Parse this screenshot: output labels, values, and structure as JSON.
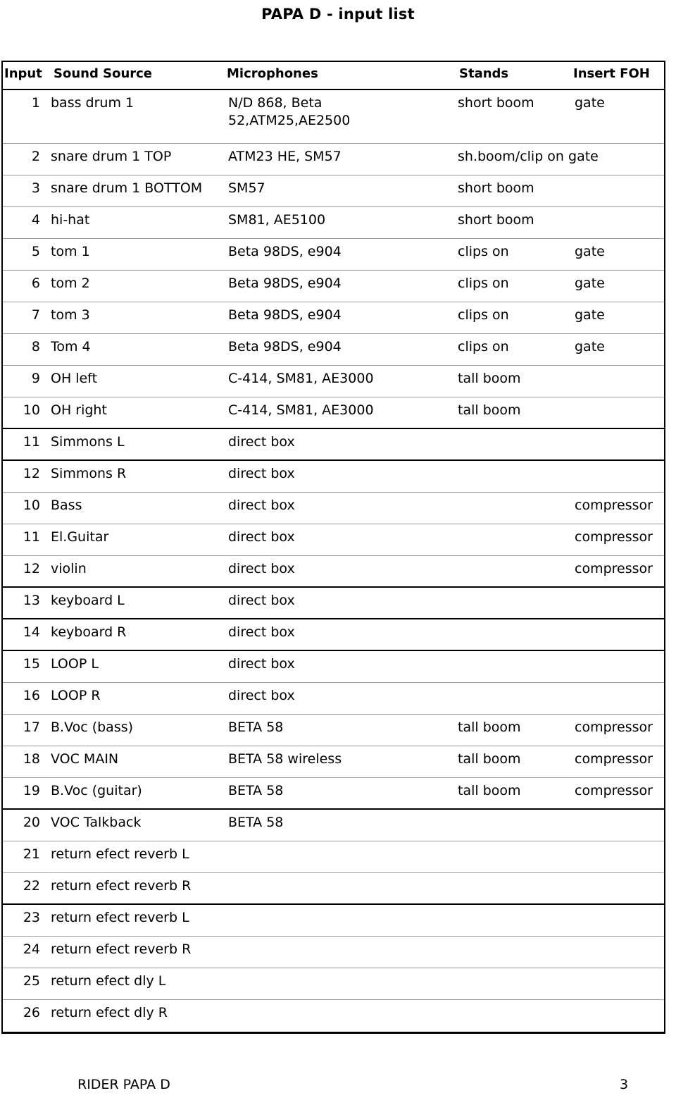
{
  "document": {
    "title": "PAPA D - input list"
  },
  "table": {
    "columns": [
      {
        "key": "input",
        "label": "Input"
      },
      {
        "key": "source",
        "label": "Sound Source"
      },
      {
        "key": "mic",
        "label": "Microphones"
      },
      {
        "key": "stand",
        "label": "Stands"
      },
      {
        "key": "insert",
        "label": "Insert FOH"
      }
    ],
    "rows": [
      {
        "input": "1",
        "source": "bass drum 1",
        "mic": "N/D 868, Beta\n52,ATM25,AE2500",
        "stand": "short boom",
        "insert": "gate"
      },
      {
        "input": "2",
        "source": "snare drum 1 TOP",
        "mic": "ATM23 HE, SM57",
        "stand": "sh.boom/clip on gate",
        "insert": ""
      },
      {
        "input": "3",
        "source": "snare drum 1 BOTTOM",
        "mic": "SM57",
        "stand": "short boom",
        "insert": ""
      },
      {
        "input": "4",
        "source": "hi-hat",
        "mic": "SM81, AE5100",
        "stand": "short boom",
        "insert": ""
      },
      {
        "input": "5",
        "source": "tom 1",
        "mic": "Beta 98DS, e904",
        "stand": "clips on",
        "insert": "gate"
      },
      {
        "input": "6",
        "source": "tom 2",
        "mic": "Beta 98DS, e904",
        "stand": "clips on",
        "insert": "gate"
      },
      {
        "input": "7",
        "source": "tom 3",
        "mic": "Beta 98DS, e904",
        "stand": "clips on",
        "insert": "gate"
      },
      {
        "input": "8",
        "source": "Tom 4",
        "mic": "Beta 98DS, e904",
        "stand": "clips on",
        "insert": "gate"
      },
      {
        "input": "9",
        "source": "OH left",
        "mic": "C-414, SM81, AE3000",
        "stand": "tall boom",
        "insert": ""
      },
      {
        "input": "10",
        "source": "OH right",
        "mic": "C-414, SM81, AE3000",
        "stand": "tall boom",
        "insert": ""
      },
      {
        "input": "11",
        "source": "Simmons L",
        "mic": "direct box",
        "stand": "",
        "insert": ""
      },
      {
        "input": "12",
        "source": "Simmons R",
        "mic": "direct box",
        "stand": "",
        "insert": ""
      },
      {
        "input": "10",
        "source": "Bass",
        "mic": "direct box",
        "stand": "",
        "insert": "compressor"
      },
      {
        "input": "11",
        "source": "El.Guitar",
        "mic": "direct box",
        "stand": "",
        "insert": "compressor"
      },
      {
        "input": "12",
        "source": "violin",
        "mic": "direct box",
        "stand": "",
        "insert": "compressor"
      },
      {
        "input": "13",
        "source": "keyboard L",
        "mic": "direct box",
        "stand": "",
        "insert": ""
      },
      {
        "input": "14",
        "source": "keyboard R",
        "mic": "direct box",
        "stand": "",
        "insert": ""
      },
      {
        "input": "15",
        "source": "LOOP L",
        "mic": "direct box",
        "stand": "",
        "insert": ""
      },
      {
        "input": "16",
        "source": "LOOP R",
        "mic": "direct box",
        "stand": "",
        "insert": ""
      },
      {
        "input": "17",
        "source": "B.Voc (bass)",
        "mic": "BETA 58",
        "stand": "tall boom",
        "insert": "compressor"
      },
      {
        "input": "18",
        "source": "VOC MAIN",
        "mic": "BETA 58 wireless",
        "stand": "tall boom",
        "insert": "compressor"
      },
      {
        "input": "19",
        "source": "B.Voc (guitar)",
        "mic": "BETA 58",
        "stand": "tall boom",
        "insert": "compressor"
      },
      {
        "input": "20",
        "source": "VOC Talkback",
        "mic": "BETA 58",
        "stand": "",
        "insert": ""
      },
      {
        "input": "21",
        "source": "return efect reverb L",
        "mic": "",
        "stand": "",
        "insert": ""
      },
      {
        "input": "22",
        "source": "return efect reverb R",
        "mic": "",
        "stand": "",
        "insert": ""
      },
      {
        "input": "23",
        "source": "return efect reverb L",
        "mic": "",
        "stand": "",
        "insert": ""
      },
      {
        "input": "24",
        "source": "return efect reverb R",
        "mic": "",
        "stand": "",
        "insert": ""
      },
      {
        "input": "25",
        "source": "return efect dly L",
        "mic": "",
        "stand": "",
        "insert": ""
      },
      {
        "input": "26",
        "source": "return efect dly R",
        "mic": "",
        "stand": "",
        "insert": ""
      }
    ]
  },
  "footer": {
    "left": "RIDER PAPA D",
    "page": "3"
  }
}
